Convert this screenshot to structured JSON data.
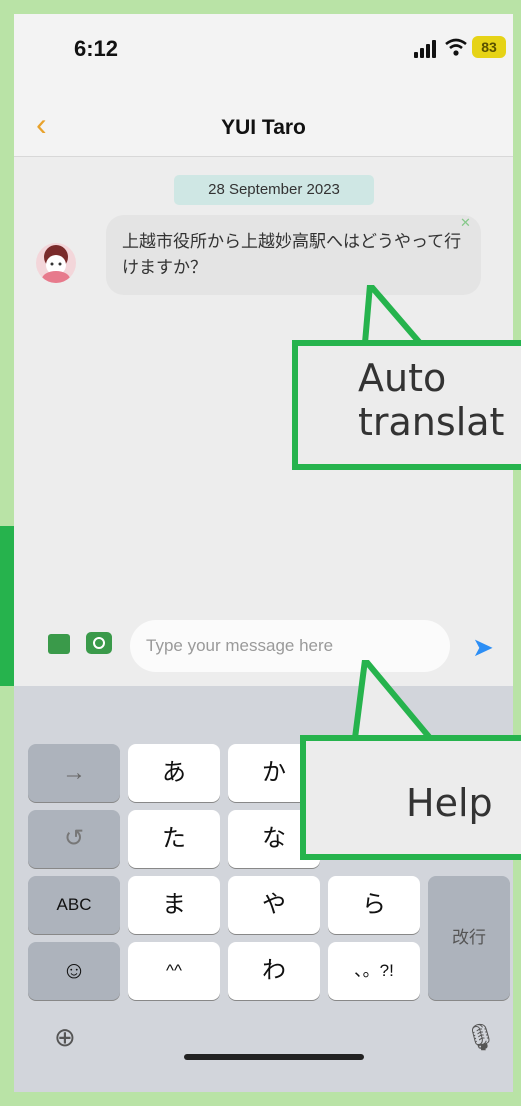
{
  "status_bar": {
    "time": "6:12",
    "battery": "83"
  },
  "header": {
    "back_icon": "chevron-left-icon",
    "title": "YUI Taro"
  },
  "chat": {
    "date": "28 September 2023",
    "message": "上越市役所から上越妙高駅へはどうやって行けますか？"
  },
  "input": {
    "placeholder": "Type your message here"
  },
  "keyboard": {
    "row1": [
      "→",
      "あ",
      "か"
    ],
    "row2": [
      "↺",
      "た",
      "な"
    ],
    "row3": [
      "ABC",
      "ま",
      "や",
      "ら"
    ],
    "row4": [
      "☺",
      "^^",
      "わ",
      "、。?!"
    ],
    "return_label": "改行"
  },
  "callouts": {
    "auto_text": "Auto\ntranslat",
    "help_text": "Help"
  },
  "colors": {
    "accent": "#e8a22c",
    "send": "#2c8ef5",
    "callout_border": "#26b34d",
    "icon_green": "#3a9a4a"
  }
}
